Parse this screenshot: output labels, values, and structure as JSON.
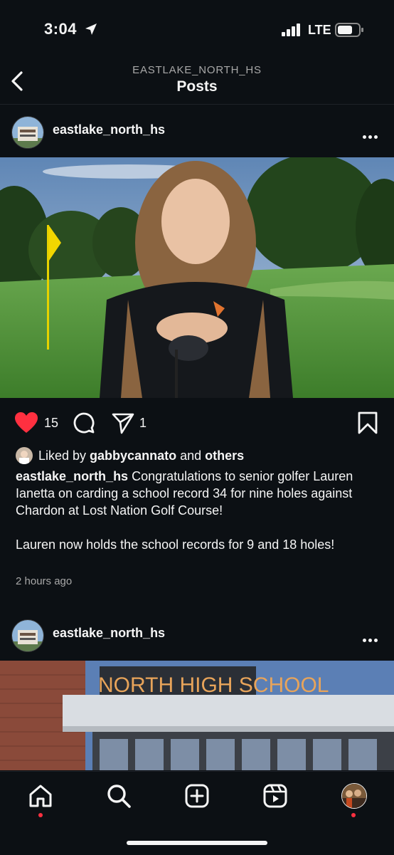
{
  "status_bar": {
    "time": "3:04",
    "network": "LTE"
  },
  "header": {
    "account": "EASTLAKE_NORTH_HS",
    "title": "Posts"
  },
  "post1": {
    "username": "eastlake_north_hs",
    "likes": "15",
    "shares": "1",
    "liked_by_prefix": "Liked by ",
    "liked_by_user": "gabbycannato",
    "liked_by_mid": " and ",
    "liked_by_others": "others",
    "caption_user": "eastlake_north_hs",
    "caption_text": " Congratulations to senior golfer Lauren Ianetta on carding a school record 34 for nine holes against Chardon at Lost Nation Golf Course!",
    "caption_text2": "Lauren now holds the school records for 9 and 18 holes!",
    "time_ago": "2 hours ago"
  },
  "post2": {
    "username": "eastlake_north_hs",
    "sign_text": "NORTH HIGH SCHOOL"
  },
  "colors": {
    "like_red": "#ff3040",
    "background": "#0c1014"
  },
  "tabs": [
    "home-icon",
    "search-icon",
    "create-icon",
    "reels-icon",
    "profile-avatar"
  ]
}
